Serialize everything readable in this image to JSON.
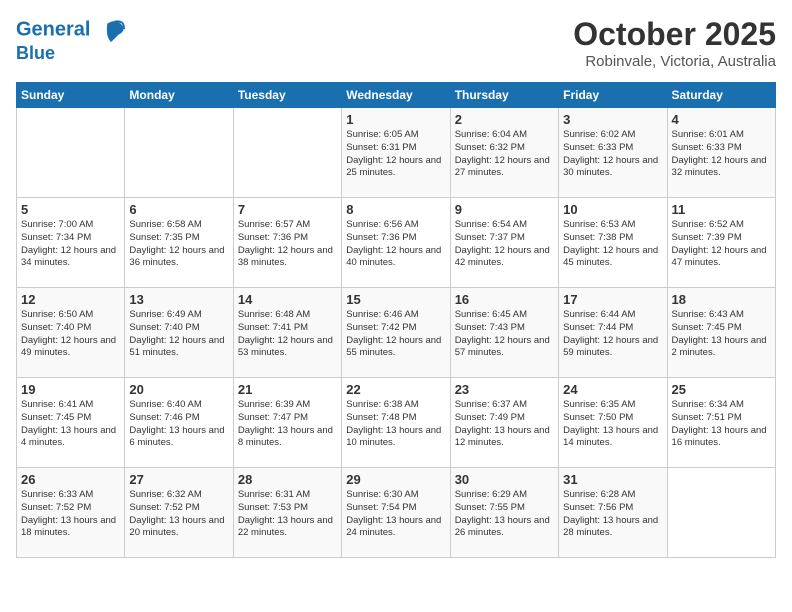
{
  "header": {
    "logo_line1": "General",
    "logo_line2": "Blue",
    "title": "October 2025",
    "subtitle": "Robinvale, Victoria, Australia"
  },
  "weekdays": [
    "Sunday",
    "Monday",
    "Tuesday",
    "Wednesday",
    "Thursday",
    "Friday",
    "Saturday"
  ],
  "weeks": [
    [
      {
        "day": "",
        "info": ""
      },
      {
        "day": "",
        "info": ""
      },
      {
        "day": "",
        "info": ""
      },
      {
        "day": "1",
        "info": "Sunrise: 6:05 AM\nSunset: 6:31 PM\nDaylight: 12 hours\nand 25 minutes."
      },
      {
        "day": "2",
        "info": "Sunrise: 6:04 AM\nSunset: 6:32 PM\nDaylight: 12 hours\nand 27 minutes."
      },
      {
        "day": "3",
        "info": "Sunrise: 6:02 AM\nSunset: 6:33 PM\nDaylight: 12 hours\nand 30 minutes."
      },
      {
        "day": "4",
        "info": "Sunrise: 6:01 AM\nSunset: 6:33 PM\nDaylight: 12 hours\nand 32 minutes."
      }
    ],
    [
      {
        "day": "5",
        "info": "Sunrise: 7:00 AM\nSunset: 7:34 PM\nDaylight: 12 hours\nand 34 minutes."
      },
      {
        "day": "6",
        "info": "Sunrise: 6:58 AM\nSunset: 7:35 PM\nDaylight: 12 hours\nand 36 minutes."
      },
      {
        "day": "7",
        "info": "Sunrise: 6:57 AM\nSunset: 7:36 PM\nDaylight: 12 hours\nand 38 minutes."
      },
      {
        "day": "8",
        "info": "Sunrise: 6:56 AM\nSunset: 7:36 PM\nDaylight: 12 hours\nand 40 minutes."
      },
      {
        "day": "9",
        "info": "Sunrise: 6:54 AM\nSunset: 7:37 PM\nDaylight: 12 hours\nand 42 minutes."
      },
      {
        "day": "10",
        "info": "Sunrise: 6:53 AM\nSunset: 7:38 PM\nDaylight: 12 hours\nand 45 minutes."
      },
      {
        "day": "11",
        "info": "Sunrise: 6:52 AM\nSunset: 7:39 PM\nDaylight: 12 hours\nand 47 minutes."
      }
    ],
    [
      {
        "day": "12",
        "info": "Sunrise: 6:50 AM\nSunset: 7:40 PM\nDaylight: 12 hours\nand 49 minutes."
      },
      {
        "day": "13",
        "info": "Sunrise: 6:49 AM\nSunset: 7:40 PM\nDaylight: 12 hours\nand 51 minutes."
      },
      {
        "day": "14",
        "info": "Sunrise: 6:48 AM\nSunset: 7:41 PM\nDaylight: 12 hours\nand 53 minutes."
      },
      {
        "day": "15",
        "info": "Sunrise: 6:46 AM\nSunset: 7:42 PM\nDaylight: 12 hours\nand 55 minutes."
      },
      {
        "day": "16",
        "info": "Sunrise: 6:45 AM\nSunset: 7:43 PM\nDaylight: 12 hours\nand 57 minutes."
      },
      {
        "day": "17",
        "info": "Sunrise: 6:44 AM\nSunset: 7:44 PM\nDaylight: 12 hours\nand 59 minutes."
      },
      {
        "day": "18",
        "info": "Sunrise: 6:43 AM\nSunset: 7:45 PM\nDaylight: 13 hours\nand 2 minutes."
      }
    ],
    [
      {
        "day": "19",
        "info": "Sunrise: 6:41 AM\nSunset: 7:45 PM\nDaylight: 13 hours\nand 4 minutes."
      },
      {
        "day": "20",
        "info": "Sunrise: 6:40 AM\nSunset: 7:46 PM\nDaylight: 13 hours\nand 6 minutes."
      },
      {
        "day": "21",
        "info": "Sunrise: 6:39 AM\nSunset: 7:47 PM\nDaylight: 13 hours\nand 8 minutes."
      },
      {
        "day": "22",
        "info": "Sunrise: 6:38 AM\nSunset: 7:48 PM\nDaylight: 13 hours\nand 10 minutes."
      },
      {
        "day": "23",
        "info": "Sunrise: 6:37 AM\nSunset: 7:49 PM\nDaylight: 13 hours\nand 12 minutes."
      },
      {
        "day": "24",
        "info": "Sunrise: 6:35 AM\nSunset: 7:50 PM\nDaylight: 13 hours\nand 14 minutes."
      },
      {
        "day": "25",
        "info": "Sunrise: 6:34 AM\nSunset: 7:51 PM\nDaylight: 13 hours\nand 16 minutes."
      }
    ],
    [
      {
        "day": "26",
        "info": "Sunrise: 6:33 AM\nSunset: 7:52 PM\nDaylight: 13 hours\nand 18 minutes."
      },
      {
        "day": "27",
        "info": "Sunrise: 6:32 AM\nSunset: 7:52 PM\nDaylight: 13 hours\nand 20 minutes."
      },
      {
        "day": "28",
        "info": "Sunrise: 6:31 AM\nSunset: 7:53 PM\nDaylight: 13 hours\nand 22 minutes."
      },
      {
        "day": "29",
        "info": "Sunrise: 6:30 AM\nSunset: 7:54 PM\nDaylight: 13 hours\nand 24 minutes."
      },
      {
        "day": "30",
        "info": "Sunrise: 6:29 AM\nSunset: 7:55 PM\nDaylight: 13 hours\nand 26 minutes."
      },
      {
        "day": "31",
        "info": "Sunrise: 6:28 AM\nSunset: 7:56 PM\nDaylight: 13 hours\nand 28 minutes."
      },
      {
        "day": "",
        "info": ""
      }
    ]
  ]
}
